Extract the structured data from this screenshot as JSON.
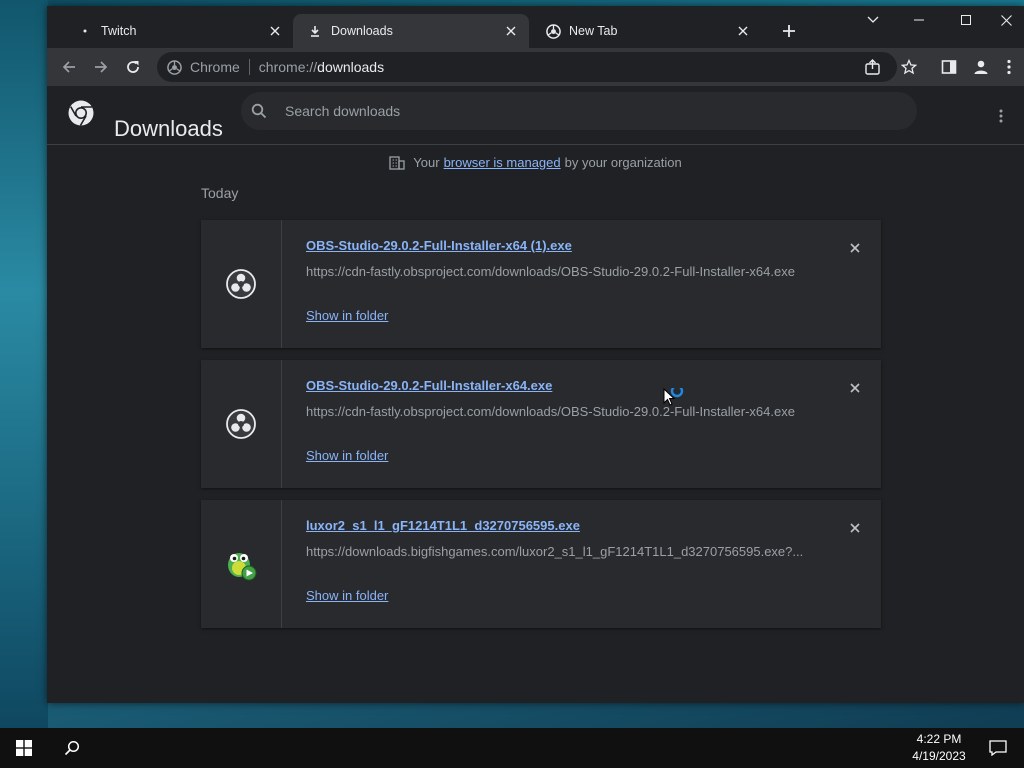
{
  "tabs": [
    {
      "title": "Twitch",
      "icon": "twitch-favicon",
      "active": false
    },
    {
      "title": "Downloads",
      "icon": "download-icon",
      "active": true
    },
    {
      "title": "New Tab",
      "icon": "chrome-icon",
      "active": false
    }
  ],
  "omnibox": {
    "site_label": "Chrome",
    "scheme": "chrome://",
    "host": "downloads"
  },
  "page": {
    "title": "Downloads",
    "search_placeholder": "Search downloads"
  },
  "managed_notice": {
    "prefix": "Your",
    "link": "browser is managed",
    "suffix": "by your organization"
  },
  "section_label": "Today",
  "downloads": [
    {
      "name": "OBS-Studio-29.0.2-Full-Installer-x64 (1).exe",
      "url": "https://cdn-fastly.obsproject.com/downloads/OBS-Studio-29.0.2-Full-Installer-x64.exe",
      "action": "Show in folder",
      "icon": "obs-icon"
    },
    {
      "name": "OBS-Studio-29.0.2-Full-Installer-x64.exe",
      "url": "https://cdn-fastly.obsproject.com/downloads/OBS-Studio-29.0.2-Full-Installer-x64.exe",
      "action": "Show in folder",
      "icon": "obs-icon"
    },
    {
      "name": "luxor2_s1_l1_gF1214T1L1_d3270756595.exe",
      "url": "https://downloads.bigfishgames.com/luxor2_s1_l1_gF1214T1L1_d3270756595.exe?...",
      "action": "Show in folder",
      "icon": "luxor-frog-icon"
    }
  ],
  "taskbar": {
    "time": "4:22 PM",
    "date": "4/19/2023"
  },
  "colors": {
    "link": "#8ab4f8",
    "page_bg": "#202124",
    "card_bg": "#292a2d",
    "toolbar_bg": "#35363a"
  }
}
